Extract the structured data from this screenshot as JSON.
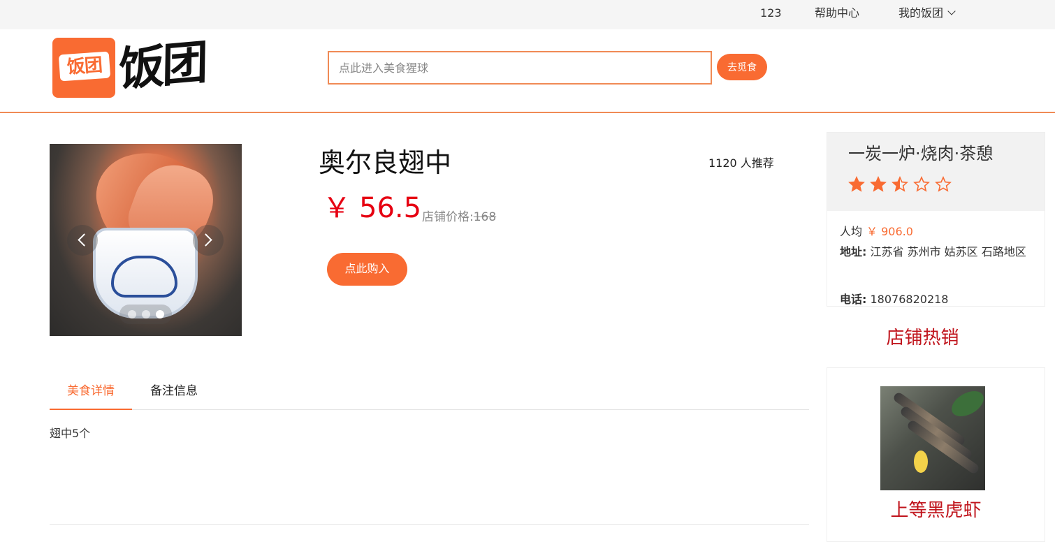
{
  "topbar": {
    "username": "123",
    "help_center": "帮助中心",
    "my_account": "我的饭团"
  },
  "header": {
    "logo_mark": "饭团",
    "logo_text": "饭团",
    "search_placeholder": "点此进入美食猩球",
    "search_button": "去觅食"
  },
  "product": {
    "name": "奥尔良翅中",
    "recommend": "1120 人推荐",
    "currency": "￥",
    "price": "56.5",
    "store_price_label": "店铺价格:",
    "store_price": "168",
    "buy_button": "点此购入",
    "carousel": {
      "slide_count": 3,
      "active_slide": 3
    }
  },
  "tabs": {
    "items": [
      {
        "label": "美食详情",
        "active": true
      },
      {
        "label": "备注信息",
        "active": false
      }
    ],
    "content": "翅中5个"
  },
  "store": {
    "name": "一炭一炉·烧肉·茶憩",
    "rating": 2.5,
    "rating_max": 5,
    "avg_label": "人均",
    "avg_value": "￥ 906.0",
    "address_label": "地址:",
    "address": "江苏省 苏州市 姑苏区 石路地区",
    "phone_label": "电话:",
    "phone": "18076820218",
    "accent_color": "#f96b32"
  },
  "hot": {
    "title": "店铺热销",
    "item_name": "上等黑虎虾"
  }
}
